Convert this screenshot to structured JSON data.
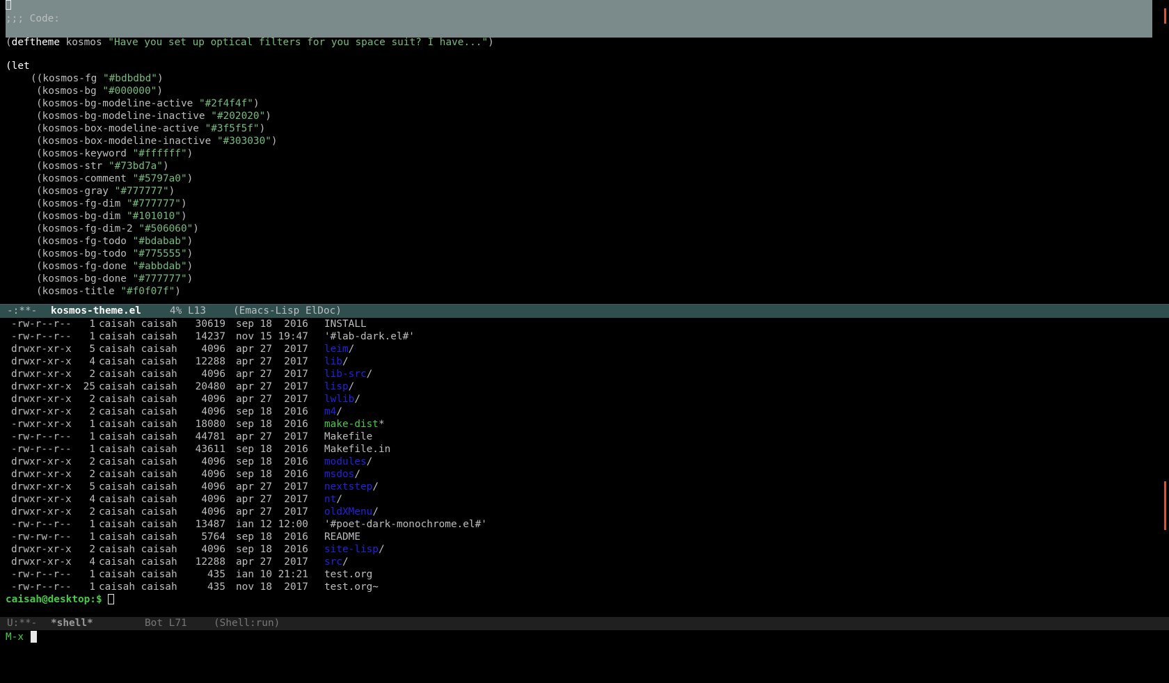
{
  "editor": {
    "header_comment": ";;; Code:",
    "deftheme": {
      "open": "(",
      "keyword": "deftheme",
      "name": " kosmos ",
      "docstring": "\"Have you set up optical filters for you space suit? I have...\"",
      "close": ")"
    },
    "let_open": "(let",
    "bindings": [
      {
        "name": "kosmos-fg",
        "value": "\"#bdbdbd\""
      },
      {
        "name": "kosmos-bg",
        "value": "\"#000000\""
      },
      {
        "name": "kosmos-bg-modeline-active",
        "value": "\"#2f4f4f\""
      },
      {
        "name": "kosmos-bg-modeline-inactive",
        "value": "\"#202020\""
      },
      {
        "name": "kosmos-box-modeline-active",
        "value": "\"#3f5f5f\""
      },
      {
        "name": "kosmos-box-modeline-inactive",
        "value": "\"#303030\""
      },
      {
        "name": "kosmos-keyword",
        "value": "\"#ffffff\""
      },
      {
        "name": "kosmos-str",
        "value": "\"#73bd7a\""
      },
      {
        "name": "kosmos-comment",
        "value": "\"#5797a0\""
      },
      {
        "name": "kosmos-gray",
        "value": "\"#777777\""
      },
      {
        "name": "kosmos-fg-dim",
        "value": "\"#777777\""
      },
      {
        "name": "kosmos-bg-dim",
        "value": "\"#101010\""
      },
      {
        "name": "kosmos-fg-dim-2",
        "value": "\"#506060\""
      },
      {
        "name": "kosmos-fg-todo",
        "value": "\"#bdabab\""
      },
      {
        "name": "kosmos-bg-todo",
        "value": "\"#775555\""
      },
      {
        "name": "kosmos-fg-done",
        "value": "\"#abbdab\""
      },
      {
        "name": "kosmos-bg-done",
        "value": "\"#777777\""
      },
      {
        "name": "kosmos-title",
        "value": "\"#f0f07f\""
      }
    ]
  },
  "modeline_active": {
    "flags": "-:**-",
    "buffer": "kosmos-theme.el",
    "position": "4% L13",
    "modes": "(Emacs-Lisp ElDoc)"
  },
  "shell": {
    "listing": [
      {
        "perm": "-rw-r--r--",
        "links": "1",
        "owner": "caisah caisah",
        "size": "30619",
        "date": "sep 18  2016",
        "name": "INSTALL",
        "suffix": "",
        "kind": "file"
      },
      {
        "perm": "-rw-r--r--",
        "links": "1",
        "owner": "caisah caisah",
        "size": "14237",
        "date": "nov 15 19:47",
        "name": "'#lab-dark.el#'",
        "suffix": "",
        "kind": "file"
      },
      {
        "perm": "drwxr-xr-x",
        "links": "5",
        "owner": "caisah caisah",
        "size": "4096",
        "date": "apr 27  2017",
        "name": "leim",
        "suffix": "/",
        "kind": "dir"
      },
      {
        "perm": "drwxr-xr-x",
        "links": "4",
        "owner": "caisah caisah",
        "size": "12288",
        "date": "apr 27  2017",
        "name": "lib",
        "suffix": "/",
        "kind": "dir"
      },
      {
        "perm": "drwxr-xr-x",
        "links": "2",
        "owner": "caisah caisah",
        "size": "4096",
        "date": "apr 27  2017",
        "name": "lib-src",
        "suffix": "/",
        "kind": "dir"
      },
      {
        "perm": "drwxr-xr-x",
        "links": "25",
        "owner": "caisah caisah",
        "size": "20480",
        "date": "apr 27  2017",
        "name": "lisp",
        "suffix": "/",
        "kind": "dir"
      },
      {
        "perm": "drwxr-xr-x",
        "links": "2",
        "owner": "caisah caisah",
        "size": "4096",
        "date": "apr 27  2017",
        "name": "lwlib",
        "suffix": "/",
        "kind": "dir"
      },
      {
        "perm": "drwxr-xr-x",
        "links": "2",
        "owner": "caisah caisah",
        "size": "4096",
        "date": "sep 18  2016",
        "name": "m4",
        "suffix": "/",
        "kind": "dir"
      },
      {
        "perm": "-rwxr-xr-x",
        "links": "1",
        "owner": "caisah caisah",
        "size": "18080",
        "date": "sep 18  2016",
        "name": "make-dist",
        "suffix": "*",
        "kind": "exe"
      },
      {
        "perm": "-rw-r--r--",
        "links": "1",
        "owner": "caisah caisah",
        "size": "44781",
        "date": "apr 27  2017",
        "name": "Makefile",
        "suffix": "",
        "kind": "file"
      },
      {
        "perm": "-rw-r--r--",
        "links": "1",
        "owner": "caisah caisah",
        "size": "43611",
        "date": "sep 18  2016",
        "name": "Makefile.in",
        "suffix": "",
        "kind": "file"
      },
      {
        "perm": "drwxr-xr-x",
        "links": "2",
        "owner": "caisah caisah",
        "size": "4096",
        "date": "sep 18  2016",
        "name": "modules",
        "suffix": "/",
        "kind": "dir"
      },
      {
        "perm": "drwxr-xr-x",
        "links": "2",
        "owner": "caisah caisah",
        "size": "4096",
        "date": "sep 18  2016",
        "name": "msdos",
        "suffix": "/",
        "kind": "dir"
      },
      {
        "perm": "drwxr-xr-x",
        "links": "5",
        "owner": "caisah caisah",
        "size": "4096",
        "date": "apr 27  2017",
        "name": "nextstep",
        "suffix": "/",
        "kind": "dir"
      },
      {
        "perm": "drwxr-xr-x",
        "links": "4",
        "owner": "caisah caisah",
        "size": "4096",
        "date": "apr 27  2017",
        "name": "nt",
        "suffix": "/",
        "kind": "dir"
      },
      {
        "perm": "drwxr-xr-x",
        "links": "2",
        "owner": "caisah caisah",
        "size": "4096",
        "date": "apr 27  2017",
        "name": "oldXMenu",
        "suffix": "/",
        "kind": "dir"
      },
      {
        "perm": "-rw-r--r--",
        "links": "1",
        "owner": "caisah caisah",
        "size": "13487",
        "date": "ian 12 12:00",
        "name": "'#poet-dark-monochrome.el#'",
        "suffix": "",
        "kind": "file"
      },
      {
        "perm": "-rw-rw-r--",
        "links": "1",
        "owner": "caisah caisah",
        "size": "5764",
        "date": "sep 18  2016",
        "name": "README",
        "suffix": "",
        "kind": "file"
      },
      {
        "perm": "drwxr-xr-x",
        "links": "2",
        "owner": "caisah caisah",
        "size": "4096",
        "date": "sep 18  2016",
        "name": "site-lisp",
        "suffix": "/",
        "kind": "dir"
      },
      {
        "perm": "drwxr-xr-x",
        "links": "4",
        "owner": "caisah caisah",
        "size": "12288",
        "date": "apr 27  2017",
        "name": "src",
        "suffix": "/",
        "kind": "dir"
      },
      {
        "perm": "-rw-r--r--",
        "links": "1",
        "owner": "caisah caisah",
        "size": "435",
        "date": "ian 10 21:21",
        "name": "test.org",
        "suffix": "",
        "kind": "file"
      },
      {
        "perm": "-rw-r--r--",
        "links": "1",
        "owner": "caisah caisah",
        "size": "435",
        "date": "nov 18  2017",
        "name": "test.org~",
        "suffix": "",
        "kind": "file"
      }
    ],
    "prompt": "caisah@desktop:$"
  },
  "modeline_inactive": {
    "flags": "U:**-",
    "buffer": "*shell*",
    "position": "Bot L71",
    "modes": "(Shell:run)"
  },
  "minibuffer": {
    "prompt": "M-x"
  },
  "colors": {
    "background": "#000000",
    "foreground": "#bdbdbd",
    "keyword": "#ffffff",
    "string": "#73bd7a",
    "modeline_active_bg": "#2f4f4f",
    "modeline_inactive_bg": "#202020",
    "header_band": "#7b8b8b",
    "directory": "#2222dd",
    "executable": "#44cc44",
    "scroll_indicator": "#d2592f"
  }
}
